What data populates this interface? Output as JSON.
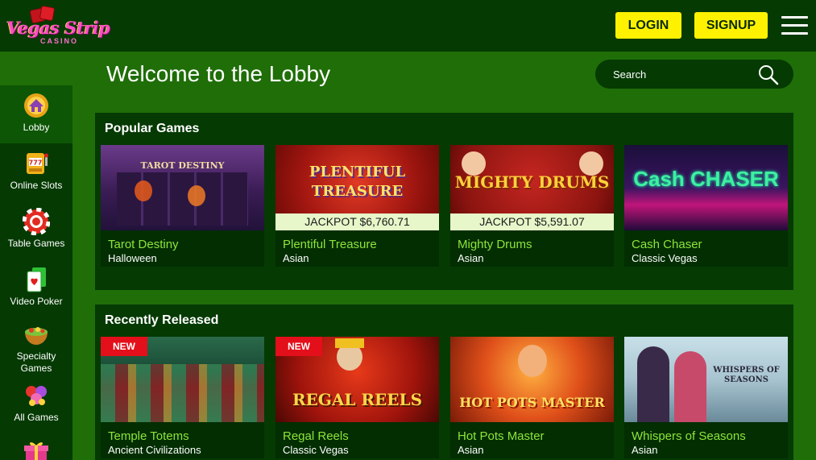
{
  "header": {
    "logo_text": "Vegas Strip",
    "logo_subtext": "CASINO",
    "login_label": "LOGIN",
    "signup_label": "SIGNUP",
    "menu_icon": "hamburger-menu-icon"
  },
  "sidebar": {
    "items": [
      {
        "label": "Lobby",
        "icon": "lobby-home-icon",
        "active": true
      },
      {
        "label": "Online Slots",
        "icon": "slot-machine-icon"
      },
      {
        "label": "Table Games",
        "icon": "casino-chip-icon"
      },
      {
        "label": "Video Poker",
        "icon": "playing-card-icon"
      },
      {
        "label": "Specialty\nGames",
        "icon": "specialty-bowl-icon"
      },
      {
        "label": "All Games",
        "icon": "balloons-icon"
      },
      {
        "label": "",
        "icon": "gift-icon"
      }
    ]
  },
  "main": {
    "title": "Welcome to the Lobby",
    "search": {
      "placeholder": "Search",
      "icon": "magnifier-icon"
    }
  },
  "sections": [
    {
      "title": "Popular Games",
      "games": [
        {
          "name": "Tarot Destiny",
          "category": "Halloween",
          "thumb_text": "TAROT DESTINY"
        },
        {
          "name": "Plentiful Treasure",
          "category": "Asian",
          "thumb_text": "PLENTIFUL TREASURE",
          "jackpot": "JACKPOT $6,760.71"
        },
        {
          "name": "Mighty Drums",
          "category": "Asian",
          "thumb_text": "MIGHTY DRUMS",
          "jackpot": "JACKPOT $5,591.07"
        },
        {
          "name": "Cash Chaser",
          "category": "Classic Vegas",
          "thumb_text": "Cash CHASER"
        }
      ]
    },
    {
      "title": "Recently Released",
      "games": [
        {
          "name": "Temple Totems",
          "category": "Ancient Civilizations",
          "badge": "NEW"
        },
        {
          "name": "Regal Reels",
          "category": "Classic Vegas",
          "badge": "NEW",
          "thumb_text": "REGAL REELS"
        },
        {
          "name": "Hot Pots Master",
          "category": "Asian",
          "thumb_text": "HOT POTS MASTER"
        },
        {
          "name": "Whispers of Seasons",
          "category": "Asian",
          "thumb_text": "WHISPERS OF SEASONS"
        }
      ]
    }
  ],
  "colors": {
    "page_bg": "#1f6e08",
    "panel_bg": "#053a03",
    "accent_yellow": "#fff200",
    "game_name_green": "#8ee53a",
    "new_badge_red": "#e30f1a",
    "jackpot_bg": "#e7f7c9"
  }
}
